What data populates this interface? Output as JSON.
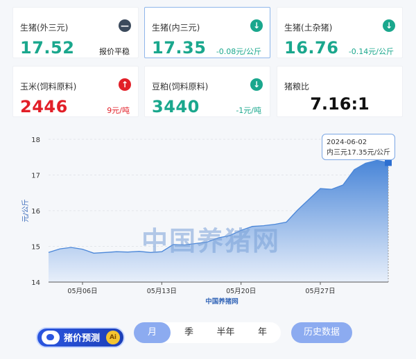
{
  "cards": [
    {
      "name": "生猪(外三元)",
      "price": "17.52",
      "change": "报价平稳",
      "badge": "—",
      "tone": "dark"
    },
    {
      "name": "生猪(内三元)",
      "price": "17.35",
      "change": "-0.08元/公斤",
      "badge": "↓",
      "tone": "green"
    },
    {
      "name": "生猪(土杂猪)",
      "price": "16.76",
      "change": "-0.14元/公斤",
      "badge": "↓",
      "tone": "green"
    },
    {
      "name": "玉米(饲料原料)",
      "price": "2446",
      "change": "9元/吨",
      "badge": "↑",
      "tone": "red"
    },
    {
      "name": "豆粕(饲料原料)",
      "price": "3440",
      "change": "-1元/吨",
      "badge": "↓",
      "tone": "green"
    },
    {
      "name": "猪粮比",
      "price": "7.16:1"
    }
  ],
  "watermark": "中国养猪网",
  "tooltip": {
    "date": "2024-06-02",
    "value": "内三元17.35元/公斤"
  },
  "controls": {
    "predict_label": "猪价预测",
    "coin_label": "Ai",
    "tabs": [
      "月",
      "季",
      "半年",
      "年"
    ],
    "selected_tab": 0,
    "history_label": "历史数据"
  },
  "colors": {
    "green": "#1aa78d",
    "red": "#e21f28",
    "accent": "#8cabf0",
    "area_top": "#3f7fd6",
    "area_bottom": "#e6eefa"
  },
  "chart_data": {
    "type": "area",
    "title": "",
    "xlabel": "中国养猪网",
    "ylabel": "元/公斤",
    "ylim": [
      14,
      18
    ],
    "yticks": [
      14,
      15,
      16,
      17,
      18
    ],
    "grid": true,
    "x_tick_labels": [
      {
        "date": "2024-05-06",
        "label": "05月06日"
      },
      {
        "date": "2024-05-13",
        "label": "05月13日"
      },
      {
        "date": "2024-05-20",
        "label": "05月20日"
      },
      {
        "date": "2024-05-27",
        "label": "05月27日"
      }
    ],
    "series": [
      {
        "x": [
          "2024-05-03",
          "2024-05-04",
          "2024-05-05",
          "2024-05-06",
          "2024-05-07",
          "2024-05-08",
          "2024-05-09",
          "2024-05-10",
          "2024-05-11",
          "2024-05-12",
          "2024-05-13",
          "2024-05-14",
          "2024-05-15",
          "2024-05-16",
          "2024-05-17",
          "2024-05-18",
          "2024-05-19",
          "2024-05-20",
          "2024-05-21",
          "2024-05-22",
          "2024-05-23",
          "2024-05-24",
          "2024-05-25",
          "2024-05-26",
          "2024-05-27",
          "2024-05-28",
          "2024-05-29",
          "2024-05-30",
          "2024-05-31",
          "2024-06-01",
          "2024-06-02"
        ],
        "y": [
          14.83,
          14.93,
          14.97,
          14.92,
          14.81,
          14.83,
          14.85,
          14.84,
          14.86,
          14.83,
          14.85,
          15.05,
          15.04,
          15.08,
          15.12,
          15.24,
          15.3,
          15.45,
          15.56,
          15.58,
          15.62,
          15.68,
          16.02,
          16.32,
          16.62,
          16.6,
          16.72,
          17.15,
          17.33,
          17.41,
          17.35
        ]
      }
    ]
  }
}
